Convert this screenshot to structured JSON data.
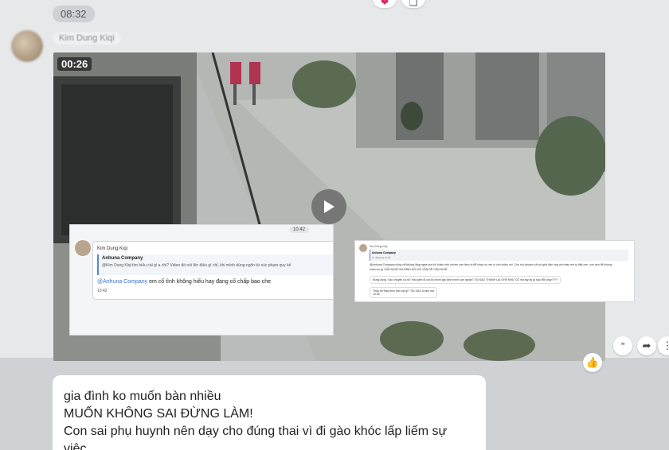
{
  "header": {
    "time_chip": "08:32"
  },
  "sender": {
    "name": "Kim Dung Kiqi"
  },
  "video": {
    "duration": "00:26",
    "play_label": "play-icon"
  },
  "screenshot_overlay_1": {
    "timestamp_top": "10:42",
    "name": "Kim Dung Kiqi",
    "quoted_author": "Anhuna Company",
    "quoted_text": "@Kim Dung Kiqi tìm hiểu cái gì a chị? Video đó nói lên điều gì chỉ, khi mình dùng ngôn từ xúc phạm quy kế",
    "reply_mention": "@Anhuna Company",
    "reply_text": " em cố tình không hiểu hay đang cố chấp bao che",
    "timestamp": "10:42"
  },
  "screenshot_overlay_2": {
    "name": "Kim Dung Kiqi",
    "quoted_author": "Anhuna Company",
    "quoted_text": "Ừ, đúng họ có lỗi.",
    "line1": "@Anhuna Company cũng chỉ không lắng nghe mà hỏi chiều nhé cái em cần làm rồi để cháy nó, em lo cho chiều nói. Con nói chuyện cả với giới đạn ông với nhau em ty hiểu em, con nếu để chứng",
    "line2": "minh em gì CẦN NGHĨ GIA ĐÌNH NỖI HỖ VẤN ĐỀ CẦN NGHĨ",
    "bubble1": "Đúng dùng \"câu chuyện cả xả\" mà quên đi cái đó chính gia đình mình cần nghĩa? TẠI SAO THÀNH LẠI GHÉ NHƯ CÓ mà tay lại gì sao đổi chạy????",
    "bubble2": "Thấy thì thấy thực làm cái gì? TẠI SAO lo làm mà",
    "bubble2_time": "10:42"
  },
  "actions": {
    "quote_icon": "quote-icon",
    "share_icon": "share-icon",
    "like_icon": "thumbs-up-icon"
  },
  "message": {
    "lines": [
      "gia đình ko muốn bàn nhiều",
      "MUỐN KHÔNG SAI ĐỪNG LÀM!",
      "Con sai phụ huynh nên dạy cho đúng thai vì đi gào khóc lấp liếm sự việc."
    ]
  },
  "colors": {
    "mention": "#3a6fd0",
    "background": "#e7e8ea",
    "heart": "#e0245e"
  }
}
